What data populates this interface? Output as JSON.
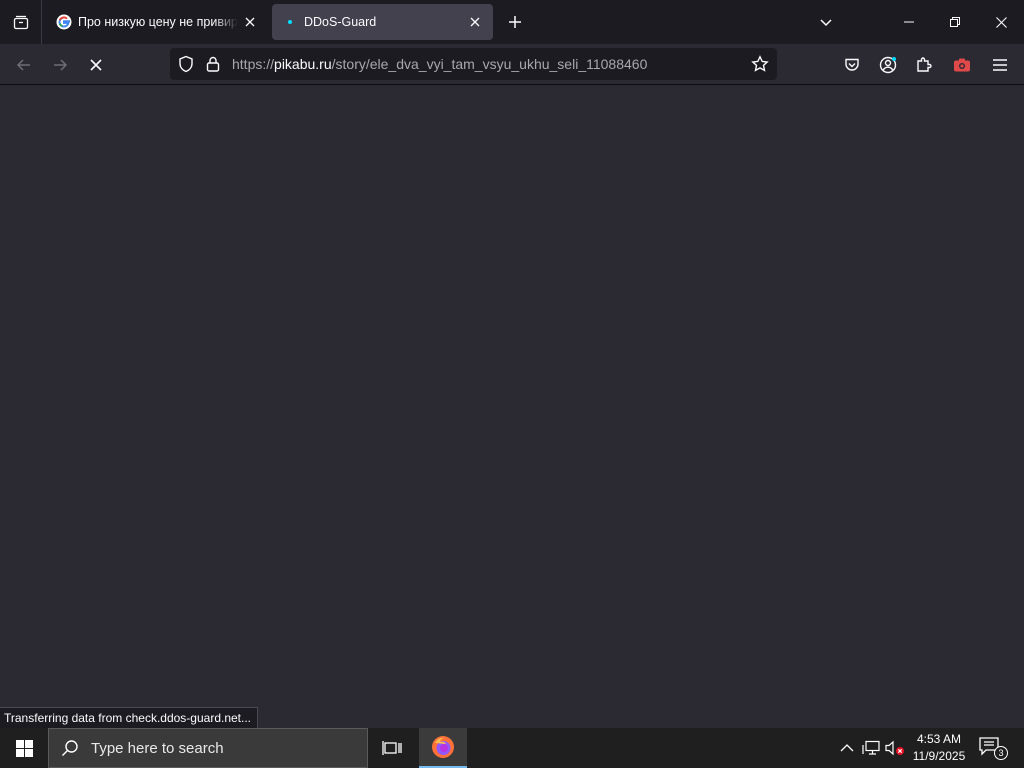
{
  "browser": {
    "tabs": [
      {
        "title": "Про низкую цену не привирай",
        "favicon": "google-icon",
        "active": false
      },
      {
        "title": "DDoS-Guard",
        "favicon": "loading-dot-icon",
        "active": true
      }
    ],
    "url": {
      "scheme": "https://",
      "host": "pikabu.ru",
      "path": "/story/ele_dva_vyi_tam_vsyu_ukhu_seli_11088460"
    },
    "status_text": "Transferring data from check.ddos-guard.net..."
  },
  "taskbar": {
    "search_placeholder": "Type here to search",
    "time": "4:53 AM",
    "date": "11/9/2025",
    "notification_count": "3"
  },
  "colors": {
    "accent": "#00ddff",
    "taskbar_active": "#76b9ed",
    "record_red": "#e04949"
  }
}
